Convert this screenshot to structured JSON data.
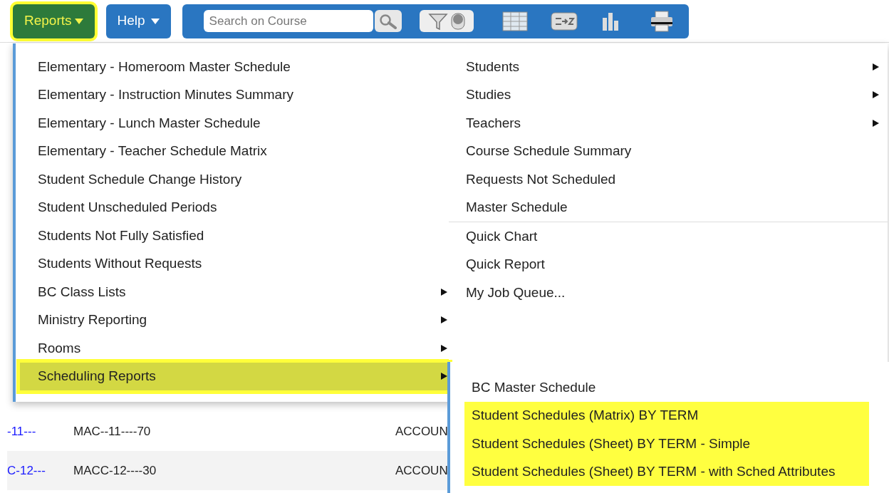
{
  "toolbar": {
    "reports_button": {
      "label": "Reports",
      "highlighted": true
    },
    "help_button": {
      "label": "Help"
    },
    "search": {
      "placeholder": "Search on Course"
    }
  },
  "table": {
    "rows": [
      {
        "cells": [
          "-11---",
          "MAC--11----70",
          "ACCOUN"
        ]
      },
      {
        "cells": [
          "C-12---",
          "MACC-12----30",
          "ACCOUN"
        ]
      }
    ]
  },
  "menu": {
    "left_items": [
      {
        "label": "Elementary - Homeroom Master Schedule",
        "submenu": false,
        "selected": false
      },
      {
        "label": "Elementary - Instruction Minutes Summary",
        "submenu": false,
        "selected": false
      },
      {
        "label": "Elementary - Lunch Master Schedule",
        "submenu": false,
        "selected": false
      },
      {
        "label": "Elementary - Teacher Schedule Matrix",
        "submenu": false,
        "selected": false
      },
      {
        "label": "Student Schedule Change History",
        "submenu": false,
        "selected": false
      },
      {
        "label": "Student Unscheduled Periods",
        "submenu": false,
        "selected": false
      },
      {
        "label": "Students Not Fully Satisfied",
        "submenu": false,
        "selected": false
      },
      {
        "label": "Students Without Requests",
        "submenu": false,
        "selected": false
      },
      {
        "label": "BC Class Lists",
        "submenu": true,
        "selected": false
      },
      {
        "label": "Ministry Reporting",
        "submenu": true,
        "selected": false
      },
      {
        "label": "Rooms",
        "submenu": true,
        "selected": false
      },
      {
        "label": "Scheduling Reports",
        "submenu": true,
        "selected": true
      }
    ],
    "right_groups": [
      [
        {
          "label": "Students",
          "submenu": true
        },
        {
          "label": "Studies",
          "submenu": true
        },
        {
          "label": "Teachers",
          "submenu": true
        },
        {
          "label": "Course Schedule Summary",
          "submenu": false
        },
        {
          "label": "Requests Not Scheduled",
          "submenu": false
        },
        {
          "label": "Master Schedule",
          "submenu": false
        }
      ],
      [
        {
          "label": "Quick Chart",
          "submenu": false
        },
        {
          "label": "Quick Report",
          "submenu": false
        },
        {
          "label": "My Job Queue...",
          "submenu": false
        }
      ]
    ]
  },
  "submenu": {
    "items": [
      {
        "label": "BC Master Schedule",
        "highlighted": false
      },
      {
        "label": "Student Schedules (Matrix) BY TERM",
        "highlighted": true
      },
      {
        "label": "Student Schedules (Sheet) BY TERM - Simple",
        "highlighted": true
      },
      {
        "label": "Student Schedules (Sheet) BY TERM - with Sched Attributes",
        "highlighted": true
      }
    ]
  }
}
